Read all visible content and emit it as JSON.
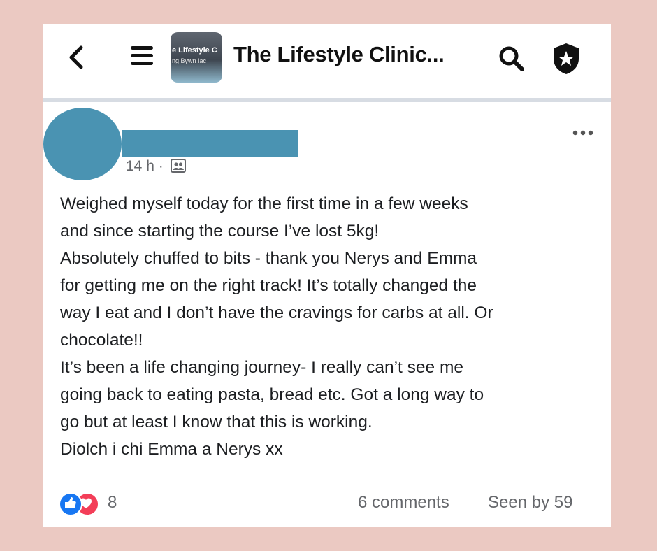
{
  "header": {
    "group_name": "The Lifestyle Clinic...",
    "thumb_line1": "e Lifestyle C",
    "thumb_line2": "ng Bywn Iac"
  },
  "post": {
    "time": "14 h ·",
    "audience_icon": "group-members-icon",
    "lines": [
      "Weighed myself today for the first time in a few weeks",
      "and since starting the course I’ve lost 5kg!",
      "Absolutely chuffed to bits - thank you Nerys and Emma",
      "for getting me on the right track! It’s totally changed the",
      "way I eat and I don’t have the cravings for carbs at all. Or",
      "chocolate!!",
      "It’s been a life changing journey- I really can’t see me",
      "going back to eating pasta, bread etc. Got a long way to",
      "go but at least I know that this is working.",
      "Diolch i chi Emma a Nerys xx"
    ]
  },
  "footer": {
    "reaction_count": "8",
    "comments": "6 comments",
    "seen_by": "Seen by 59"
  },
  "colors": {
    "background": "#ebc9c2",
    "redaction": "#4a93b2",
    "like": "#1877f2",
    "love": "#f33e58"
  }
}
